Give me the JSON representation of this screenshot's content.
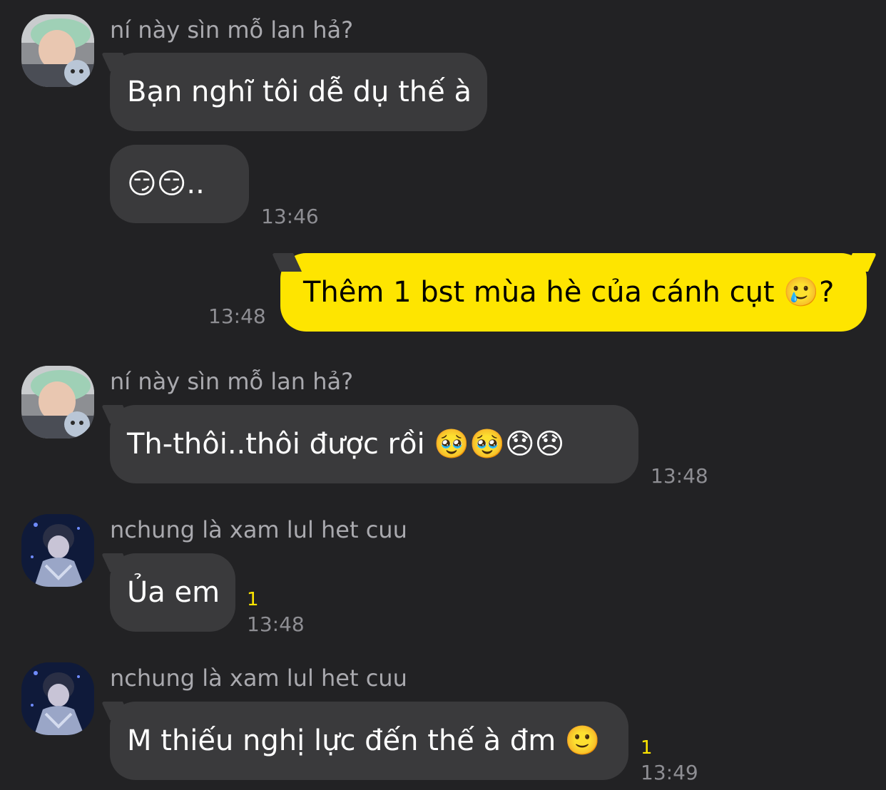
{
  "theme": {
    "background": "#222224",
    "bubble_incoming": "#3a3a3c",
    "bubble_outgoing": "#fee500",
    "unread_color": "#fee500"
  },
  "messages": [
    {
      "sender": "ní này sìn mỗ lan hả?",
      "avatar": "avatar-photo-1",
      "text": "Bạn nghĩ tôi dễ dụ thế à"
    },
    {
      "text": "😏😏..",
      "time": "13:46"
    },
    {
      "text": "Thêm 1 bst mùa hè của cánh cụt 🥲?",
      "time": "13:48"
    },
    {
      "sender": "ní này sìn mỗ lan hả?",
      "avatar": "avatar-photo-1",
      "text": "Th-thôi..thôi được rồi 🥹🥹😞😞",
      "time": "13:48"
    },
    {
      "sender": "nchung là xam lul het cuu",
      "avatar": "avatar-photo-2",
      "text": "Ủa em",
      "unread": "1",
      "time": "13:48"
    },
    {
      "sender": "nchung là xam lul het cuu",
      "avatar": "avatar-photo-2",
      "text": "M thiếu nghị lực đến thế à đm 🙂",
      "unread": "1",
      "time": "13:49"
    }
  ]
}
